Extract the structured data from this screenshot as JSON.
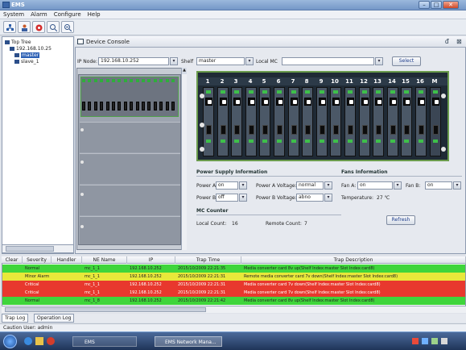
{
  "window": {
    "title": "EMS"
  },
  "menu": [
    "System",
    "Alarm",
    "Configure",
    "Help"
  ],
  "tree": {
    "root": "Top Tree",
    "node": "192.168.10.25",
    "children": [
      "master",
      "slave_1"
    ]
  },
  "console": {
    "title": "Device Console",
    "ip_label": "IP Node:",
    "ip_value": "192.168.10.252",
    "shelf_label": "Shelf",
    "shelf_value": "master",
    "local_mc_label": "Local MC",
    "select_button": "Select"
  },
  "chassis": {
    "slots": [
      "1",
      "2",
      "3",
      "4",
      "5",
      "6",
      "7",
      "8",
      "9",
      "10",
      "11",
      "12",
      "13",
      "14",
      "15",
      "16",
      "M"
    ]
  },
  "power": {
    "title": "Power Supply Information",
    "power_a_label": "Power A:",
    "power_a_value": "on",
    "power_a_voltage_label": "Power A Voltage:",
    "power_a_voltage_value": "normal",
    "power_b_label": "Power B:",
    "power_b_value": "off",
    "power_b_voltage_label": "Power B Voltage:",
    "power_b_voltage_value": "abno"
  },
  "fans": {
    "title": "Fans Information",
    "fan_a_label": "Fan A:",
    "fan_a_value": "on",
    "fan_b_label": "Fan B:",
    "fan_b_value": "on",
    "temp_label": "Temperature:",
    "temp_value": "27 ℃"
  },
  "counter": {
    "title": "MC Counter",
    "local_label": "Local Count:",
    "local_value": "16",
    "remote_label": "Remote Count:",
    "remote_value": "7",
    "refresh_button": "Refresh"
  },
  "alarm": {
    "columns": [
      "Clear",
      "Severity",
      "Handler",
      "NE Name",
      "IP",
      "Trap Time",
      "Trap Description"
    ],
    "rows": [
      {
        "severity": "Normal",
        "ne": "mc_1_1",
        "ip": "192.168.10.252",
        "time": "2015/10/2009 22:21:35",
        "desc": "Media converter card 8v up(Shelf Index:master Slot Index:card8)",
        "color": "#3fd53b"
      },
      {
        "severity": "Minor Alarm",
        "ne": "mc_1_1",
        "ip": "192.168.10.252",
        "time": "2015/10/2009 22:21:31",
        "desc": "Remote media converter card 7v down(Shelf Index:master Slot Index:card8)",
        "color": "#e8e83a"
      },
      {
        "severity": "Critical",
        "ne": "mc_1_1",
        "ip": "192.168.10.252",
        "time": "2015/10/2009 22:21:31",
        "desc": "Media converter card 7v down(Shelf Index:master Slot Index:card8)",
        "color": "#e8382e"
      },
      {
        "severity": "Critical",
        "ne": "mc_1_1",
        "ip": "192.168.10.252",
        "time": "2015/10/2009 22:21:31",
        "desc": "Media converter card 7v down(Shelf Index:master Slot Index:card8)",
        "color": "#e8382e"
      },
      {
        "severity": "Normal",
        "ne": "mc_1_8",
        "ip": "192.168.10.252",
        "time": "2015/10/2009 22:21:42",
        "desc": "Media converter card 8v up(Shelf Index:master Slot Index:card8)",
        "color": "#3fd53b"
      }
    ]
  },
  "tabs": [
    "Trap Log",
    "Operation Log"
  ],
  "status": "Caution User: admin",
  "taskbar": {
    "task1": "EMS",
    "task2": "EMS Network Mana..."
  }
}
